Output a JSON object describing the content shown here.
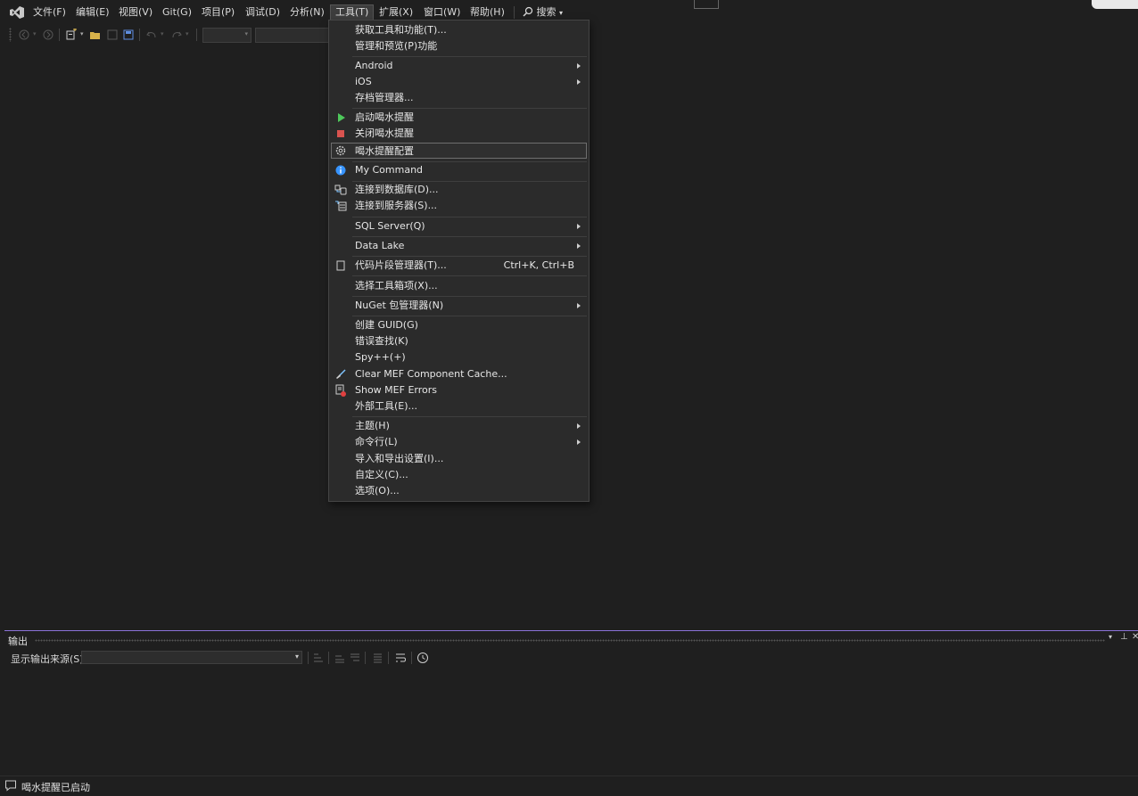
{
  "menubar": {
    "items": [
      {
        "label": "文件(F)"
      },
      {
        "label": "编辑(E)"
      },
      {
        "label": "视图(V)"
      },
      {
        "label": "Git(G)"
      },
      {
        "label": "项目(P)"
      },
      {
        "label": "调试(D)"
      },
      {
        "label": "分析(N)"
      },
      {
        "label": "工具(T)"
      },
      {
        "label": "扩展(X)"
      },
      {
        "label": "窗口(W)"
      },
      {
        "label": "帮助(H)"
      }
    ],
    "search_label": "搜索"
  },
  "tools_menu": {
    "items": [
      {
        "label": "获取工具和功能(T)..."
      },
      {
        "label": "管理和预览(P)功能"
      },
      {
        "label": "Android"
      },
      {
        "label": "iOS"
      },
      {
        "label": "存档管理器..."
      },
      {
        "label": "启动喝水提醒",
        "icon": "play-icon"
      },
      {
        "label": "关闭喝水提醒",
        "icon": "stop-icon"
      },
      {
        "label": "喝水提醒配置",
        "icon": "gear-icon"
      },
      {
        "label": "My Command",
        "icon": "info-icon"
      },
      {
        "label": "连接到数据库(D)...",
        "icon": "database-connect-icon"
      },
      {
        "label": "连接到服务器(S)...",
        "icon": "server-connect-icon"
      },
      {
        "label": "SQL Server(Q)"
      },
      {
        "label": "Data Lake"
      },
      {
        "label": "代码片段管理器(T)...",
        "icon": "snippet-icon",
        "shortcut": "Ctrl+K, Ctrl+B"
      },
      {
        "label": "选择工具箱项(X)..."
      },
      {
        "label": "NuGet 包管理器(N)"
      },
      {
        "label": "创建 GUID(G)"
      },
      {
        "label": "错误查找(K)"
      },
      {
        "label": "Spy++(+)"
      },
      {
        "label": "Clear MEF Component Cache...",
        "icon": "broom-icon"
      },
      {
        "label": "Show MEF Errors",
        "icon": "error-list-icon"
      },
      {
        "label": "外部工具(E)..."
      },
      {
        "label": "主题(H)"
      },
      {
        "label": "命令行(L)"
      },
      {
        "label": "导入和导出设置(I)..."
      },
      {
        "label": "自定义(C)..."
      },
      {
        "label": "选项(O)..."
      }
    ]
  },
  "output_panel": {
    "title": "输出",
    "source_label": "显示输出来源(S):",
    "source_value": ""
  },
  "statusbar": {
    "text": "喝水提醒已启动"
  },
  "colors": {
    "background": "#1f1f1f",
    "menu_bg": "#2b2b2b",
    "accent": "#8a72d8",
    "play": "#4ec95b",
    "stop": "#d9534f",
    "info": "#3794ff"
  }
}
